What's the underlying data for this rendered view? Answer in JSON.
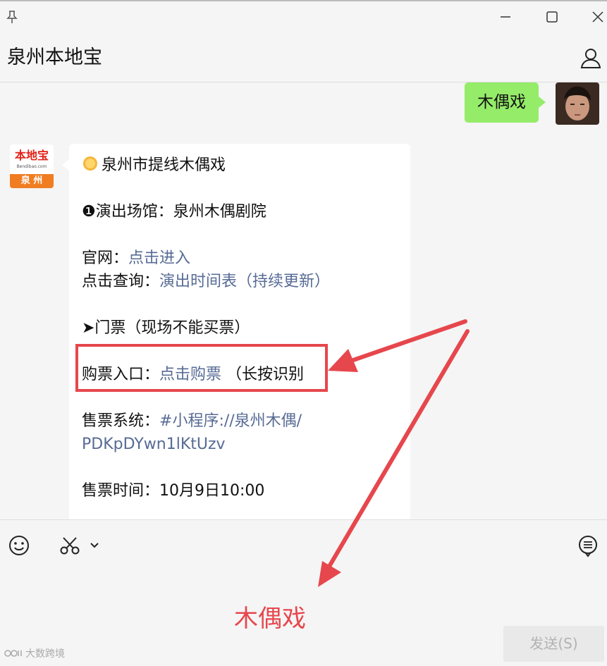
{
  "window": {
    "title": "泉州本地宝"
  },
  "chat": {
    "outgoing_text": "木偶戏",
    "incoming": {
      "line1": "泉州市提线木偶戏",
      "line2": "❶演出场馆：泉州木偶剧院",
      "line3_prefix": "官网：",
      "line3_link": "点击进入",
      "line4_prefix": "点击查询：",
      "line4_link": "演出时间表（持续更新）",
      "line5": "➤门票（现场不能买票）",
      "line6_prefix": "购票入口：",
      "line6_link": "点击购票",
      "line6_suffix": " （长按识别",
      "line7_prefix": "售票系统：",
      "line7_link": "#小程序://泉州木偶/",
      "line8_link": "PDKpDYwn1lKtUzv",
      "line9": "售票时间：10月9日10:00"
    },
    "logo": {
      "top": "本地宝",
      "small": "Bendibao.com",
      "bottom": "泉 州"
    }
  },
  "input": {
    "typed_text": "木偶戏",
    "send_label": "发送(S)"
  },
  "watermark": "大数跨境",
  "colors": {
    "accent_green": "#95ec69",
    "link": "#576b95",
    "annotation_red": "#e6474d"
  }
}
